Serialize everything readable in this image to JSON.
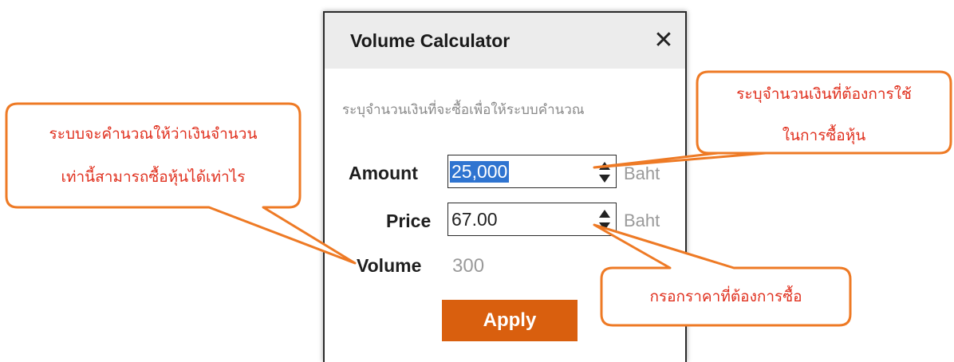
{
  "dialog": {
    "title": "Volume Calculator",
    "close_icon": "close-icon",
    "instruction": "ระบุจำนวนเงินที่จะซื้อเพื่อให้ระบบคำนวณ",
    "amount": {
      "label": "Amount",
      "value": "25,000",
      "unit": "Baht"
    },
    "price": {
      "label": "Price",
      "value": "67.00",
      "unit": "Baht"
    },
    "volume": {
      "label": "Volume",
      "value": "300"
    },
    "apply_label": "Apply"
  },
  "callouts": {
    "left_line1": "ระบบจะคำนวณให้ว่าเงินจำนวน",
    "left_line2": "เท่านี้สามารถซื้อหุ้นได้เท่าไร",
    "right_line1": "ระบุจำนวนเงินที่ต้องการใช้",
    "right_line2": "ในการซื้อหุ้น",
    "bottom": "กรอกราคาที่ต้องการซื้อ"
  },
  "colors": {
    "accent": "#d95f0e",
    "callout_border": "#ee7a25",
    "callout_text": "#e0301e",
    "selection": "#2f74d0"
  }
}
